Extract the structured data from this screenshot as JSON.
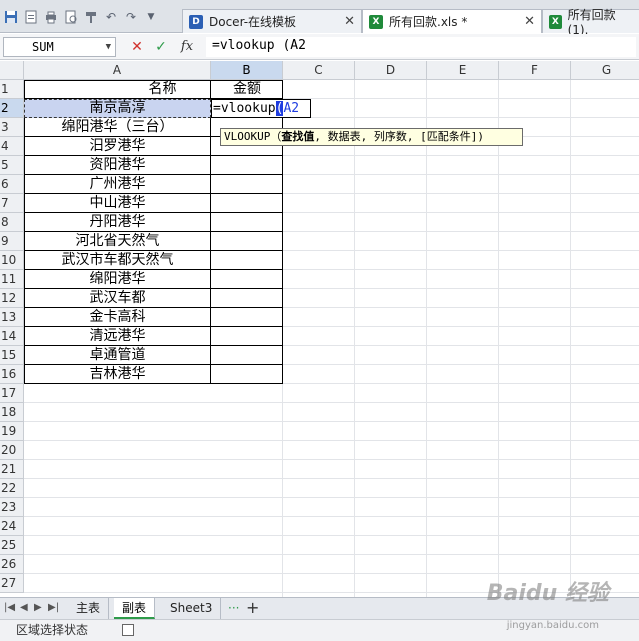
{
  "window": {
    "tabs": [
      {
        "label": "Docer-在线模板",
        "icon": "docer-icon",
        "close": "✕"
      },
      {
        "label": "所有回款.xls *",
        "icon": "xls-icon",
        "close": "✕"
      },
      {
        "label": "所有回款 (1).",
        "icon": "xls-icon"
      }
    ]
  },
  "formula_bar": {
    "name_box": "SUM",
    "cancel": "✕",
    "confirm": "✓",
    "fx": "fx",
    "formula": "=vlookup (A2"
  },
  "columns": [
    "A",
    "B",
    "C",
    "D",
    "E",
    "F",
    "G"
  ],
  "rows": [
    "1",
    "2",
    "3",
    "4",
    "5",
    "6",
    "7",
    "8",
    "9",
    "10",
    "11",
    "12",
    "13",
    "14",
    "15",
    "16",
    "17",
    "18",
    "19",
    "20",
    "21",
    "22",
    "23",
    "24",
    "25",
    "26",
    "27"
  ],
  "table": {
    "header_a": "名称",
    "header_b": "金额",
    "names": [
      "南京高淳",
      "绵阳港华（三台）",
      "汨罗港华",
      "资阳港华",
      "广州港华",
      "中山港华",
      "丹阳港华",
      "河北省天然气",
      "武汉市车都天然气",
      "绵阳港华",
      "武汉车都",
      "金卡高科",
      "清远港华",
      "卓通管道",
      "吉林港华"
    ]
  },
  "edit_cell": {
    "prefix": "=vlookup",
    "paren": "(",
    "ref": "A2"
  },
  "tooltip": {
    "fn": "VLOOKUP",
    "open": "（",
    "arg1": "查找值",
    "rest": ", 数据表, 列序数, [匹配条件])"
  },
  "sheets": [
    "主表",
    "副表",
    "Sheet3"
  ],
  "sheet_more": "···",
  "sheet_add": "+",
  "status": "区域选择状态",
  "watermark": "Baidu 经验",
  "watermark_url": "jingyan.baidu.com",
  "colors": {
    "selection": "#c9d4f0",
    "accent": "#1f3de0",
    "active_tab": "#2e9b4a"
  }
}
